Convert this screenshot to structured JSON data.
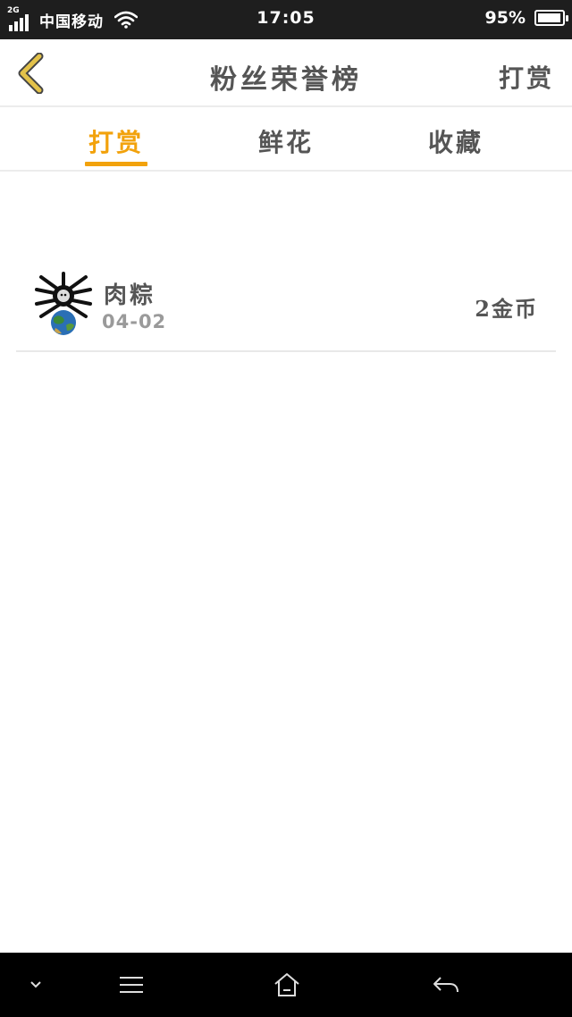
{
  "status_bar": {
    "network_type": "2G",
    "carrier": "中国移动",
    "time": "17:05",
    "battery_text": "95%",
    "battery_level": 0.95
  },
  "header": {
    "back_icon": "chevron-left-icon",
    "title": "粉丝荣誉榜",
    "action_label": "打赏"
  },
  "tabs": [
    {
      "label": "打赏",
      "active": true
    },
    {
      "label": "鲜花",
      "active": false
    },
    {
      "label": "收藏",
      "active": false
    }
  ],
  "list": [
    {
      "name": "肉粽",
      "date": "04-02",
      "amount": "2金币"
    }
  ],
  "nav_bar": {
    "icons": [
      "chevron-down-icon",
      "menu-icon",
      "home-icon",
      "back-arrow-icon"
    ]
  },
  "colors": {
    "accent": "#f2a20c",
    "text": "#555555",
    "muted": "#9a9a9a",
    "status_bar_bg": "#1e1e1e",
    "nav_bar_bg": "#000000",
    "back_chevron": "#e3c24a"
  }
}
